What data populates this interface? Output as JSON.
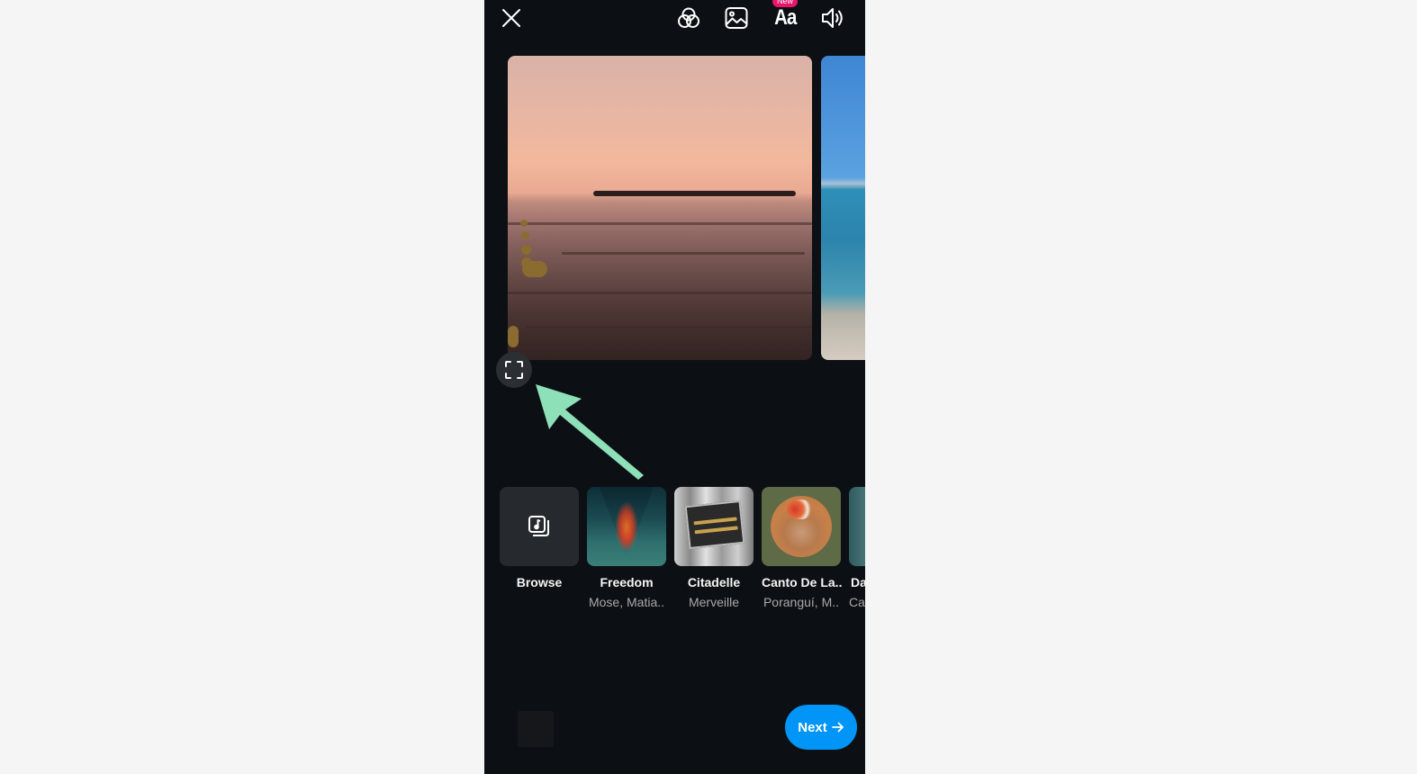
{
  "top_bar": {
    "close_icon": "close-icon",
    "filter_icon": "filter-icon",
    "sticker_icon": "image-icon",
    "text_icon_label": "Aa",
    "text_new_badge": "New",
    "audio_icon": "volume-icon"
  },
  "media": {
    "items": [
      {
        "name": "sunset-beach-photo"
      },
      {
        "name": "blue-sea-photo"
      }
    ],
    "fullscreen_icon": "fullscreen-icon"
  },
  "annotation": {
    "arrow_color": "#8ee0b8"
  },
  "music": {
    "items": [
      {
        "title": "Browse",
        "artist": ""
      },
      {
        "title": "Freedom",
        "artist": "Mose, Matia.."
      },
      {
        "title": "Citadelle",
        "artist": "Merveille"
      },
      {
        "title": "Canto De La..",
        "artist": "Poranguí, M.."
      },
      {
        "title": "Da",
        "artist": "Ca"
      }
    ]
  },
  "bottom": {
    "next_label": "Next",
    "next_color": "#0095f6"
  },
  "colors": {
    "background": "#0c1014",
    "badge": "#e8156b"
  }
}
